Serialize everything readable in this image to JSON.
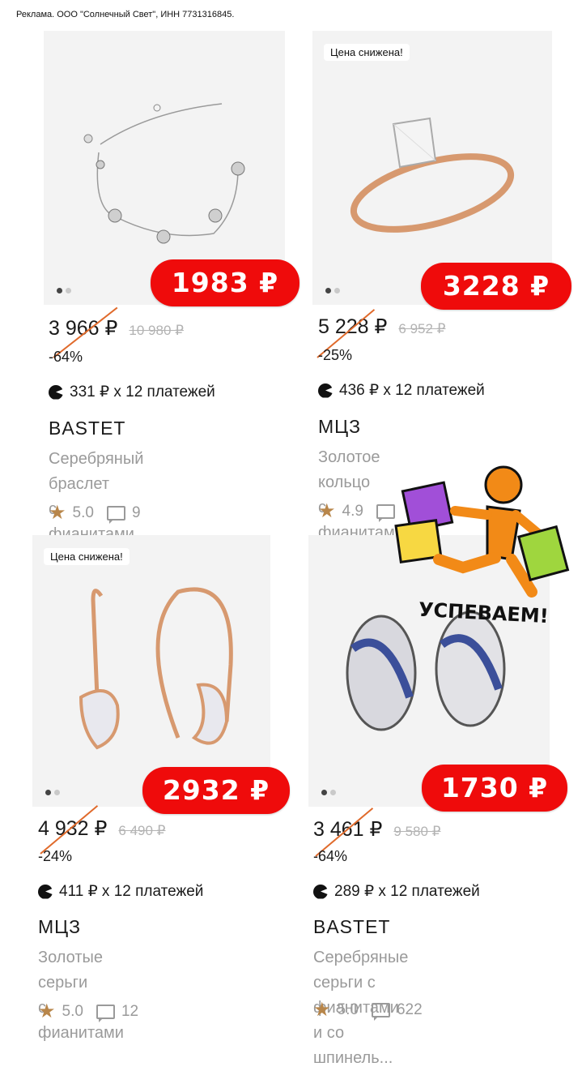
{
  "ad_note": "Реклама. ООО \"Солнечный Свет\", ИНН 7731316845.",
  "cards": [
    {
      "tag": "",
      "promo": "1983 ₽",
      "price": "3 966 ₽",
      "old_price": "10 980 ₽",
      "discount": "-64%",
      "installment": "331 ₽ x 12 платежей",
      "brand": "BASTET",
      "title_line1": "Серебряный браслет",
      "title_line2": "с фианитами",
      "rating": "5.0",
      "reviews": "9"
    },
    {
      "tag": "Цена снижена!",
      "promo": "3228 ₽",
      "price": "5 228 ₽",
      "old_price": "6 952 ₽",
      "discount": "-25%",
      "installment": "436 ₽ x 12 платежей",
      "brand": "МЦЗ",
      "title_line1": "Золотое кольцо",
      "title_line2": "с фианитами",
      "rating": "4.9",
      "reviews": ""
    },
    {
      "tag": "Цена снижена!",
      "promo": "2932 ₽",
      "price": "4 932 ₽",
      "old_price": "6 490 ₽",
      "discount": "-24%",
      "installment": "411 ₽ x 12 платежей",
      "brand": "МЦЗ",
      "title_line1": "Золотые серьги",
      "title_line2": "с фианитами",
      "rating": "5.0",
      "reviews": "12"
    },
    {
      "tag": "",
      "promo": "1730 ₽",
      "price": "3 461 ₽",
      "old_price": "9 580 ₽",
      "discount": "-64%",
      "installment": "289 ₽ x 12 платежей",
      "brand": "BASTET",
      "title_line1": "Серебряные серьги с",
      "title_line2": "фианитами и со шпинель...",
      "rating": "5.0",
      "reviews": "622"
    }
  ],
  "sticker": {
    "text": "УСПЕВАЕМ!"
  },
  "colors": {
    "promo": "#ef0b0b",
    "slash": "#e06a2b",
    "star": "#b8864a"
  }
}
